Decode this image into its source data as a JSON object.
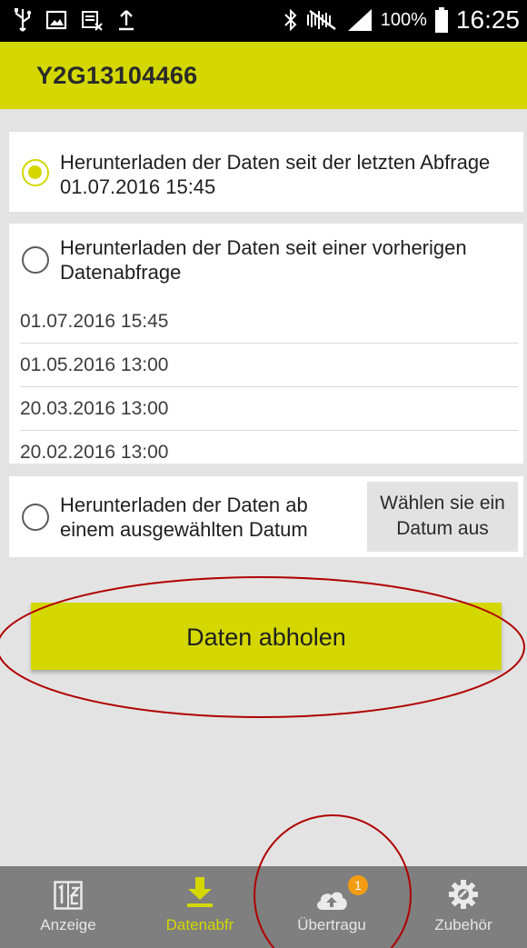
{
  "status_bar": {
    "icons_left": [
      "usb-icon",
      "image-icon",
      "cellular-data-icon",
      "upload-icon"
    ],
    "icons_right": [
      "bluetooth-icon",
      "mute-icon",
      "signal-icon",
      "battery-icon"
    ],
    "battery_percent": "100%",
    "time": "16:25"
  },
  "header": {
    "title": "Y2G13104466"
  },
  "options": {
    "last_query": {
      "label": "Herunterladen der Daten seit der letzten Abfrage",
      "date": "01.07.2016 15:45",
      "selected": true
    },
    "previous_query": {
      "label_line1": "Herunterladen der Daten seit einer vorherigen",
      "label_line2": "Datenabfrage",
      "selected": false,
      "dates": [
        "01.07.2016 15:45",
        "01.05.2016 13:00",
        "20.03.2016 13:00",
        "20.02.2016 13:00"
      ]
    },
    "selected_date": {
      "label_line1": "Herunterladen der Daten ab",
      "label_line2": "einem ausgewählten Datum",
      "selected": false,
      "button_line1": "Wählen sie ein",
      "button_line2": "Datum aus"
    }
  },
  "primary_button": {
    "label": "Daten abholen"
  },
  "bottom_nav": {
    "items": [
      {
        "label": "Anzeige",
        "icon": "display-icon",
        "active": false
      },
      {
        "label": "Datenabfr",
        "icon": "download-icon",
        "active": true
      },
      {
        "label": "Übertragu",
        "icon": "cloud-upload-icon",
        "active": false,
        "badge": "1"
      },
      {
        "label": "Zubehör",
        "icon": "gear-icon",
        "active": false
      }
    ]
  },
  "colors": {
    "accent": "#d4d800",
    "annotation": "#b00000",
    "nav_background": "#7f7f7f",
    "badge": "#f39c12"
  }
}
